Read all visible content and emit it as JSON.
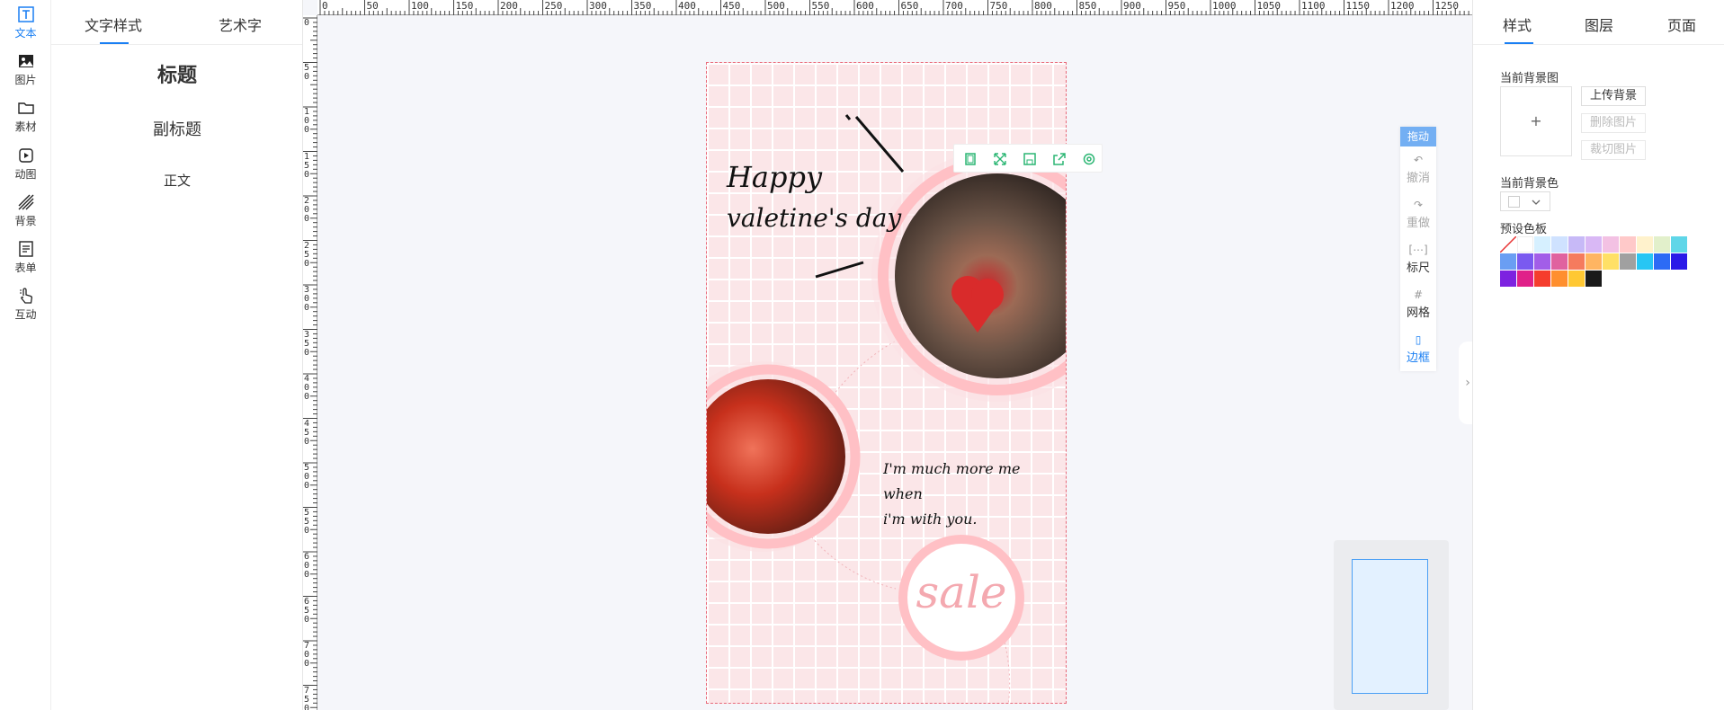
{
  "rail": [
    {
      "label": "文本",
      "icon": "text-icon",
      "active": true
    },
    {
      "label": "图片",
      "icon": "image-icon",
      "active": false
    },
    {
      "label": "素材",
      "icon": "folder-icon",
      "active": false
    },
    {
      "label": "动图",
      "icon": "play-icon",
      "active": false
    },
    {
      "label": "背景",
      "icon": "stripes-icon",
      "active": false
    },
    {
      "label": "表单",
      "icon": "form-icon",
      "active": false
    },
    {
      "label": "互动",
      "icon": "hand-pointer-icon",
      "active": false
    }
  ],
  "text_panel": {
    "tabs": [
      "文字样式",
      "艺术字"
    ],
    "presets": {
      "title": "标题",
      "subtitle": "副标题",
      "body": "正文"
    }
  },
  "ruler": {
    "top": [
      "0",
      "50",
      "100",
      "150",
      "200",
      "250",
      "300",
      "350",
      "400",
      "450",
      "500",
      "550",
      "600",
      "650",
      "700",
      "750",
      "800",
      "850",
      "900",
      "950",
      "1000",
      "1050",
      "1100",
      "1150",
      "1200",
      "1250"
    ],
    "left": [
      "0",
      "50",
      "100",
      "150",
      "200",
      "250",
      "300",
      "350",
      "400",
      "450",
      "500",
      "550",
      "600",
      "650",
      "700",
      "750"
    ]
  },
  "poster": {
    "headline_1": "Happy",
    "headline_2": "valetine's day",
    "quote_1": "I'm much more me",
    "quote_2": "when",
    "quote_3": "i'm with you.",
    "badge": "sale"
  },
  "float_toolbar": [
    "copy-icon",
    "expand-icon",
    "save-icon",
    "share-icon",
    "settings-icon"
  ],
  "tools": {
    "drag": "拖动",
    "undo": "撤消",
    "redo": "重做",
    "ruler": "标尺",
    "grid": "网格",
    "border": "边框"
  },
  "right_panel": {
    "tabs": [
      "样式",
      "图层",
      "页面"
    ],
    "current_bg_image": "当前背景图",
    "upload_bg": "上传背景",
    "delete_image": "删除图片",
    "crop_image": "裁切图片",
    "current_bg_color": "当前背景色",
    "preset_palette": "预设色板",
    "plus": "+"
  },
  "palette": [
    "#ffffff",
    "#d6f0ff",
    "#cfe2ff",
    "#c7b9f7",
    "#d9b8f5",
    "#f3c1e3",
    "#ffc9c9",
    "#fff2cc",
    "#e2f0cb",
    "#5fd6e8",
    "#6a9ef3",
    "#7a5af0",
    "#a25ee8",
    "#e0629f",
    "#f57b5e",
    "#ffb562",
    "#ffe066",
    "#a0a0a0",
    "#27c6f4",
    "#2d6bf5",
    "#2a1ae8",
    "#7d22e0",
    "#e02089",
    "#f53d2d",
    "#ff8f2e",
    "#ffc833",
    "#1a1a1a"
  ],
  "colors": {
    "accent": "#1a7ff3",
    "poster_bg": "#fbe6e8",
    "pink": "#ffc0c5"
  }
}
